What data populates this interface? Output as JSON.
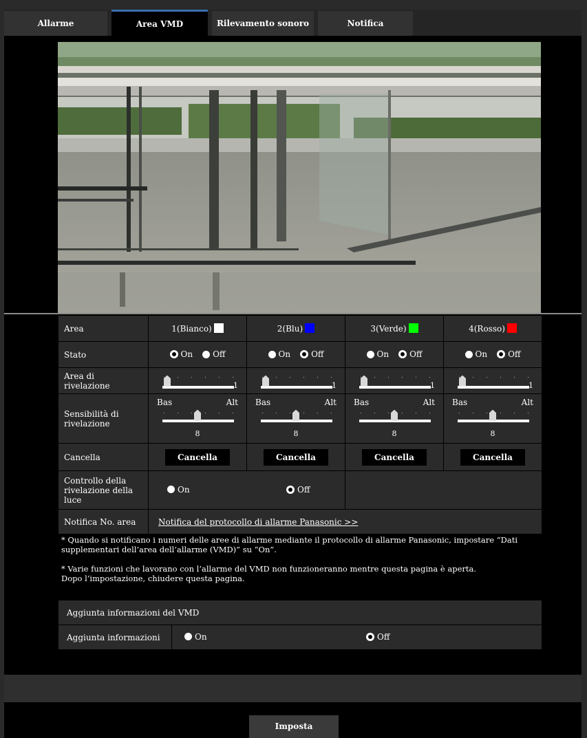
{
  "tabs": [
    {
      "label": "Allarme",
      "active": false
    },
    {
      "label": "Area VMD",
      "active": true
    },
    {
      "label": "Rilevamento sonoro",
      "active": false
    },
    {
      "label": "Notifica",
      "active": false
    }
  ],
  "areas": {
    "header": "Area",
    "columns": [
      {
        "label": "1(Bianco)",
        "color": "#ffffff"
      },
      {
        "label": "2(Blu)",
        "color": "#0000ff"
      },
      {
        "label": "3(Verde)",
        "color": "#00ff00"
      },
      {
        "label": "4(Rosso)",
        "color": "#ff0000"
      }
    ]
  },
  "stato": {
    "label": "Stato",
    "on_label": "On",
    "off_label": "Off",
    "values": [
      "On",
      "Off",
      "Off",
      "Off"
    ]
  },
  "area_rivelazione": {
    "label": "Area di rivelazione",
    "values": [
      "1",
      "1",
      "1",
      "1"
    ]
  },
  "sensibilita": {
    "label": "Sensibilità di rivelazione",
    "low_label": "Bas",
    "high_label": "Alt",
    "values": [
      "8",
      "8",
      "8",
      "8"
    ]
  },
  "cancella": {
    "label": "Cancella",
    "button_label": "Cancella"
  },
  "controllo_luce": {
    "label": "Controllo della rivelazione della luce",
    "on_label": "On",
    "off_label": "Off",
    "value": "Off"
  },
  "notifica_area": {
    "label": "Notifica No. area",
    "link_text": "Notifica del protocollo di allarme Panasonic >>"
  },
  "notes": {
    "note1": "* Quando si notificano i numeri delle aree di allarme mediante il protocollo di allarme Panasonic, impostare “Dati supplementari dell’area dell’allarme (VMD)” su “On”.",
    "note2_line1": "* Varie funzioni che lavorano con l’allarme del VMD non funzioneranno mentre questa pagina è aperta.",
    "note2_line2": "Dopo l’impostazione, chiudere questa pagina."
  },
  "vmd_info": {
    "header": "Aggiunta informazioni del VMD",
    "label": "Aggiunta informazioni",
    "on_label": "On",
    "off_label": "Off",
    "value": "Off"
  },
  "submit_label": "Imposta"
}
